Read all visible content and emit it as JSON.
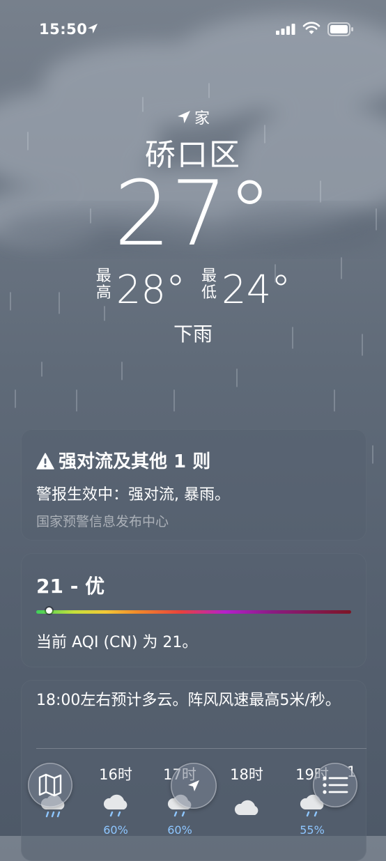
{
  "status_bar": {
    "time": "15:50"
  },
  "header": {
    "location_label": "家",
    "city": "硚口区",
    "temperature": "27°",
    "high_label_top": "最",
    "high_label_bottom": "高",
    "high_value": "28°",
    "low_label_top": "最",
    "low_label_bottom": "低",
    "low_value": "24°",
    "condition": "下雨"
  },
  "alert": {
    "title": "强对流及其他 1 则",
    "body": "警报生效中：强对流, 暴雨。",
    "source": "国家预警信息发布中心"
  },
  "aqi": {
    "value_text": "21 - 优",
    "description": "当前 AQI (CN) 为 21。",
    "level_fraction": 0.04
  },
  "hourly": {
    "summary": "18:00左右预计多云。阵风风速最高5米/秒。",
    "hours": [
      {
        "label": "",
        "icon": "heavy-rain-icon",
        "pct": ""
      },
      {
        "label": "16时",
        "icon": "rain-icon",
        "pct": "60%"
      },
      {
        "label": "17时",
        "icon": "rain-icon",
        "pct": "60%"
      },
      {
        "label": "18时",
        "icon": "cloud-icon",
        "pct": ""
      },
      {
        "label": "19时",
        "icon": "rain-icon",
        "pct": "55%"
      },
      {
        "label": "1",
        "icon": "rain-icon",
        "pct": ""
      }
    ]
  },
  "colors": {
    "precip_blue": "#8ec6ff",
    "background_top": "#77808c",
    "background_bottom": "#4e5968"
  },
  "bottom_bar": {
    "map_icon": "map-icon",
    "location_icon": "location-arrow-icon",
    "list_icon": "list-icon"
  }
}
